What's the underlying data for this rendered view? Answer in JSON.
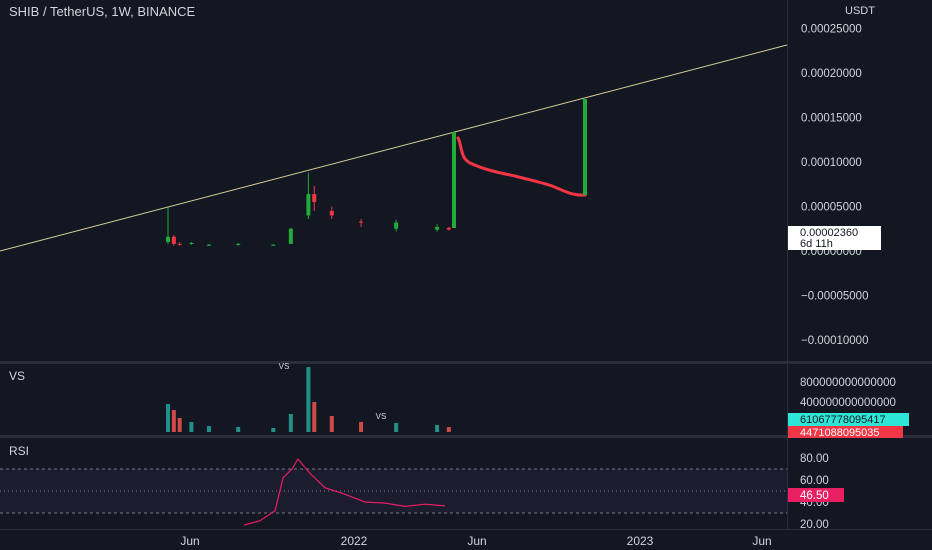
{
  "header": {
    "symbol_title": "SHIB / TetherUS, 1W, BINANCE"
  },
  "price_axis": {
    "unit": "USDT",
    "ticks": [
      {
        "label": "0.00025000",
        "value": 0.00025
      },
      {
        "label": "0.00020000",
        "value": 0.0002
      },
      {
        "label": "0.00015000",
        "value": 0.00015
      },
      {
        "label": "0.00010000",
        "value": 0.0001
      },
      {
        "label": "0.00005000",
        "value": 5e-05
      },
      {
        "label": "0.00000000",
        "value": 0
      },
      {
        "label": "−0.00005000",
        "value": -5e-05
      },
      {
        "label": "−0.00010000",
        "value": -0.0001
      }
    ],
    "last_price_label": "0.00002360",
    "countdown_label": "6d 11h"
  },
  "volume_pane": {
    "label": "VS",
    "tick_labels": [
      "800000000000000",
      "400000000000000"
    ],
    "tag_up": "61067778095417",
    "tag_down": "4471088095035",
    "annotation": "VS",
    "colors": {
      "up": "#26a69a",
      "down": "#ef5350"
    }
  },
  "rsi_pane": {
    "label": "RSI",
    "ticks": [
      "80.00",
      "60.00",
      "40.00",
      "20.00"
    ],
    "current_label": "46.50",
    "color": "#e91e63"
  },
  "time_axis": {
    "labels": [
      "Jun",
      "2022",
      "Jun",
      "2023",
      "Jun"
    ]
  },
  "chart_data": {
    "type": "candlestick",
    "series": [
      {
        "name": "SHIB / TetherUS",
        "points": [
          {
            "t": "2021-05-10",
            "o": 1e-05,
            "h": 4.9e-05,
            "l": 8e-06,
            "c": 1.6e-05
          },
          {
            "t": "2021-05-17",
            "o": 1.6e-05,
            "h": 1.8e-05,
            "l": 6e-06,
            "c": 8e-06
          },
          {
            "t": "2021-05-24",
            "o": 8e-06,
            "h": 1e-05,
            "l": 6e-06,
            "c": 7e-06
          },
          {
            "t": "2021-06-07",
            "o": 8e-06,
            "h": 1e-05,
            "l": 7e-06,
            "c": 9e-06
          },
          {
            "t": "2021-06-28",
            "o": 7e-06,
            "h": 8e-06,
            "l": 6e-06,
            "c": 7e-06
          },
          {
            "t": "2021-08-02",
            "o": 7e-06,
            "h": 9e-06,
            "l": 6e-06,
            "c": 8e-06
          },
          {
            "t": "2021-09-13",
            "o": 7e-06,
            "h": 8e-06,
            "l": 7e-06,
            "c": 7e-06
          },
          {
            "t": "2021-10-04",
            "o": 8e-06,
            "h": 2.6e-05,
            "l": 8e-06,
            "c": 2.5e-05
          },
          {
            "t": "2021-10-25",
            "o": 4e-05,
            "h": 8.8e-05,
            "l": 3.6e-05,
            "c": 6.4e-05
          },
          {
            "t": "2021-11-01",
            "o": 6.4e-05,
            "h": 7.3e-05,
            "l": 4.5e-05,
            "c": 5.5e-05
          },
          {
            "t": "2021-11-22",
            "o": 4.5e-05,
            "h": 5e-05,
            "l": 3.6e-05,
            "c": 4e-05
          },
          {
            "t": "2021-12-27",
            "o": 3.3e-05,
            "h": 3.6e-05,
            "l": 2.7e-05,
            "c": 3.2e-05
          },
          {
            "t": "2022-02-07",
            "o": 2.5e-05,
            "h": 3.5e-05,
            "l": 2.2e-05,
            "c": 3.2e-05
          },
          {
            "t": "2022-03-28",
            "o": 2.4e-05,
            "h": 3e-05,
            "l": 2.2e-05,
            "c": 2.7e-05
          },
          {
            "t": "2022-04-11",
            "o": 2.6e-05,
            "h": 2.7e-05,
            "l": 2.3e-05,
            "c": 2.4e-05
          }
        ]
      }
    ],
    "rsi_range": [
      20,
      80
    ],
    "x_labels": [
      "Jun",
      "2022",
      "Jun",
      "2023",
      "Jun"
    ],
    "y_range": [
      -0.00011,
      0.00028
    ]
  }
}
